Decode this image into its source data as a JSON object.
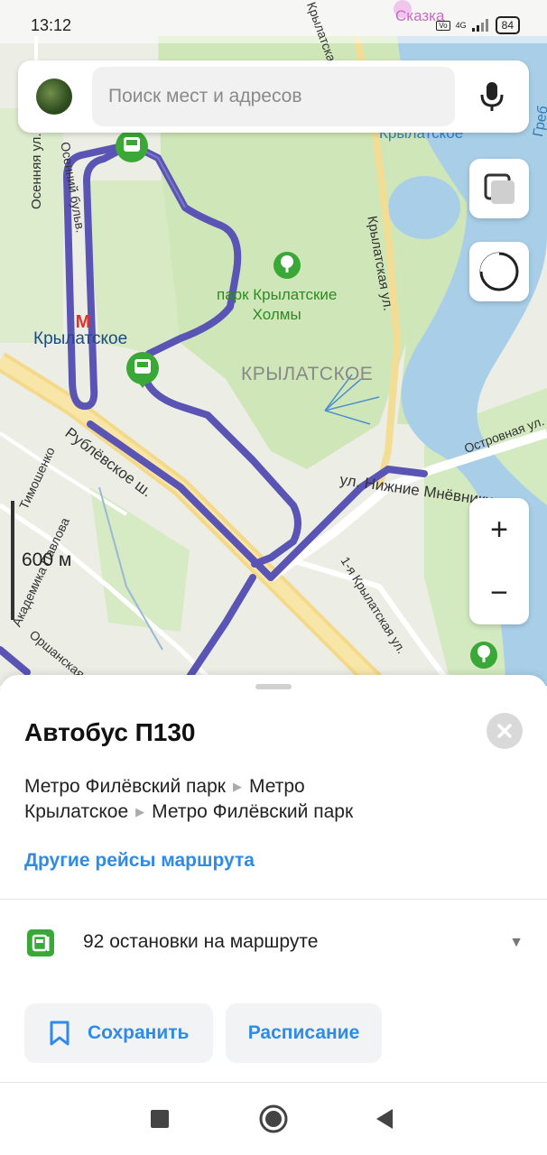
{
  "status_bar": {
    "time": "13:12",
    "battery": "84",
    "network": "4G"
  },
  "search": {
    "placeholder": "Поиск мест и адресов"
  },
  "map": {
    "labels": {
      "metro_station": "Крылатское",
      "park": "парк Крылатские\nХолмы",
      "district": "КРЫЛАТСКОЕ",
      "skazka": "Сказка",
      "krylatskoe_top": "Крылатское",
      "grebnoy": "Греб",
      "street_osennyaya": "Осенняя ул.",
      "street_osenniy_blvd": "Осенний бульв.",
      "street_krylatskaya": "Крылатская ул.",
      "street_krylatskaya_top": "Крылатская ул.",
      "street_rublevskoe": "Рублёвское ш.",
      "street_nizhnie_mnevniki": "ул. Нижние Мнёвники",
      "street_ostrovnaya": "Островная ул.",
      "street_1_krylatskaya": "1-я Крылатская ул.",
      "street_akademika_pavlova": "Академика Павлова",
      "street_timoshenko": "Тимошенко",
      "street_orshanskaya": "Оршанская"
    },
    "scale_label": "600 м",
    "zoom_in": "+",
    "zoom_out": "−",
    "route_color": "#5a55b4"
  },
  "sheet": {
    "title": "Автобус П130",
    "route_stops": [
      "Метро Филёвский парк",
      "Метро Крылатское",
      "Метро Филёвский парк"
    ],
    "other_trips_link": "Другие рейсы маршрута",
    "stops_count": "92 остановки на маршруте",
    "save_label": "Сохранить",
    "schedule_label": "Расписание"
  },
  "colors": {
    "accent": "#2f8be6",
    "stop_green": "#3aa836"
  }
}
